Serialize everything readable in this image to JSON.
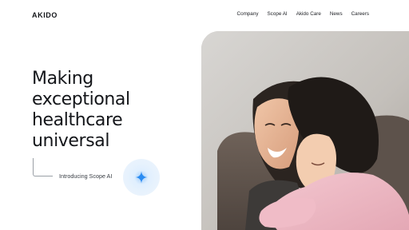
{
  "brand": {
    "logo": "AKIDO"
  },
  "nav": {
    "items": [
      {
        "label": "Company"
      },
      {
        "label": "Scope AI"
      },
      {
        "label": "Akido Care"
      },
      {
        "label": "News"
      },
      {
        "label": "Careers"
      }
    ]
  },
  "hero": {
    "headline_lines": [
      "Making",
      "exceptional",
      "healthcare",
      "universal"
    ],
    "intro_link": "Introducing Scope AI",
    "image_subject": "woman-hugging-child-photo",
    "orb_icon": "sparkle-icon"
  },
  "colors": {
    "text": "#14161a",
    "accent": "#2b8cf2",
    "orb": "#e4f0fc"
  }
}
